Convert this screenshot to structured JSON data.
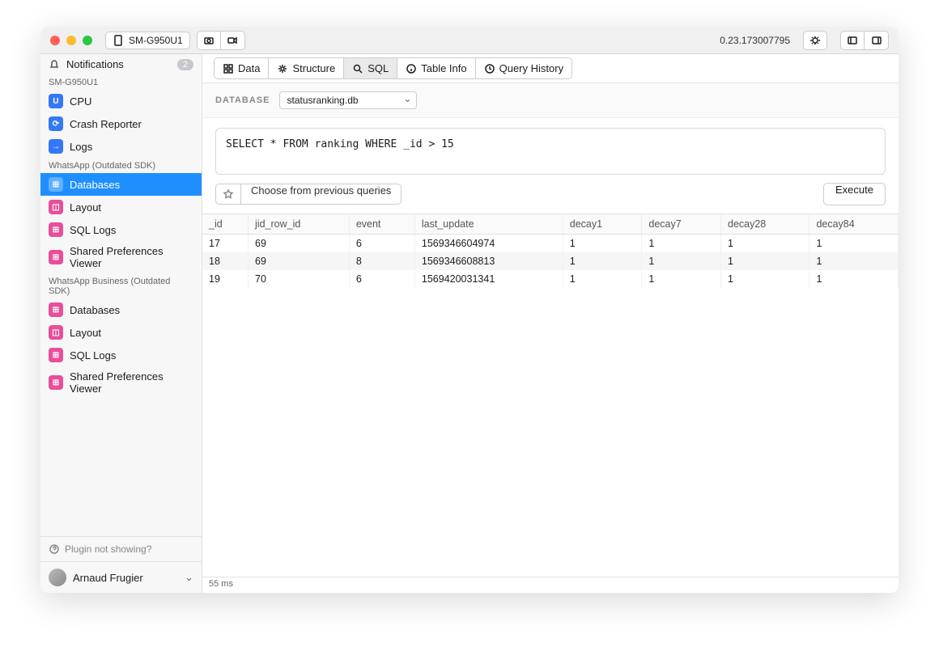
{
  "titlebar": {
    "device": "SM-G950U1",
    "version": "0.23.173007795"
  },
  "sidebar": {
    "notifications_label": "Notifications",
    "notifications_badge": "2",
    "groups": [
      {
        "label": "SM-G950U1",
        "items": [
          {
            "icon": "U",
            "color": "blue",
            "label": "CPU"
          },
          {
            "icon": "⟳",
            "color": "blue",
            "label": "Crash Reporter"
          },
          {
            "icon": "→",
            "color": "blue",
            "label": "Logs"
          }
        ]
      },
      {
        "label": "WhatsApp (Outdated SDK)",
        "items": [
          {
            "icon": "⊞",
            "color": "pink",
            "label": "Databases",
            "active": true
          },
          {
            "icon": "◫",
            "color": "pink",
            "label": "Layout"
          },
          {
            "icon": "⊞",
            "color": "pink",
            "label": "SQL Logs"
          },
          {
            "icon": "⊞",
            "color": "pink",
            "label": "Shared Preferences Viewer"
          }
        ]
      },
      {
        "label": "WhatsApp Business (Outdated SDK)",
        "items": [
          {
            "icon": "⊞",
            "color": "pink",
            "label": "Databases"
          },
          {
            "icon": "◫",
            "color": "pink",
            "label": "Layout"
          },
          {
            "icon": "⊞",
            "color": "pink",
            "label": "SQL Logs"
          },
          {
            "icon": "⊞",
            "color": "pink",
            "label": "Shared Preferences Viewer"
          }
        ]
      }
    ],
    "help": "Plugin not showing?",
    "user": "Arnaud Frugier"
  },
  "tabs": {
    "data": "Data",
    "structure": "Structure",
    "sql": "SQL",
    "table_info": "Table Info",
    "query_history": "Query History"
  },
  "database": {
    "label": "DATABASE",
    "selected": "statusranking.db"
  },
  "sql_query": "SELECT * FROM ranking WHERE _id > 15",
  "buttons": {
    "previous": "Choose from previous queries",
    "execute": "Execute"
  },
  "table": {
    "columns": [
      "_id",
      "jid_row_id",
      "event",
      "last_update",
      "decay1",
      "decay7",
      "decay28",
      "decay84"
    ],
    "rows": [
      [
        "17",
        "69",
        "6",
        "1569346604974",
        "1",
        "1",
        "1",
        "1"
      ],
      [
        "18",
        "69",
        "8",
        "1569346608813",
        "1",
        "1",
        "1",
        "1"
      ],
      [
        "19",
        "70",
        "6",
        "1569420031341",
        "1",
        "1",
        "1",
        "1"
      ]
    ]
  },
  "status": "55 ms"
}
